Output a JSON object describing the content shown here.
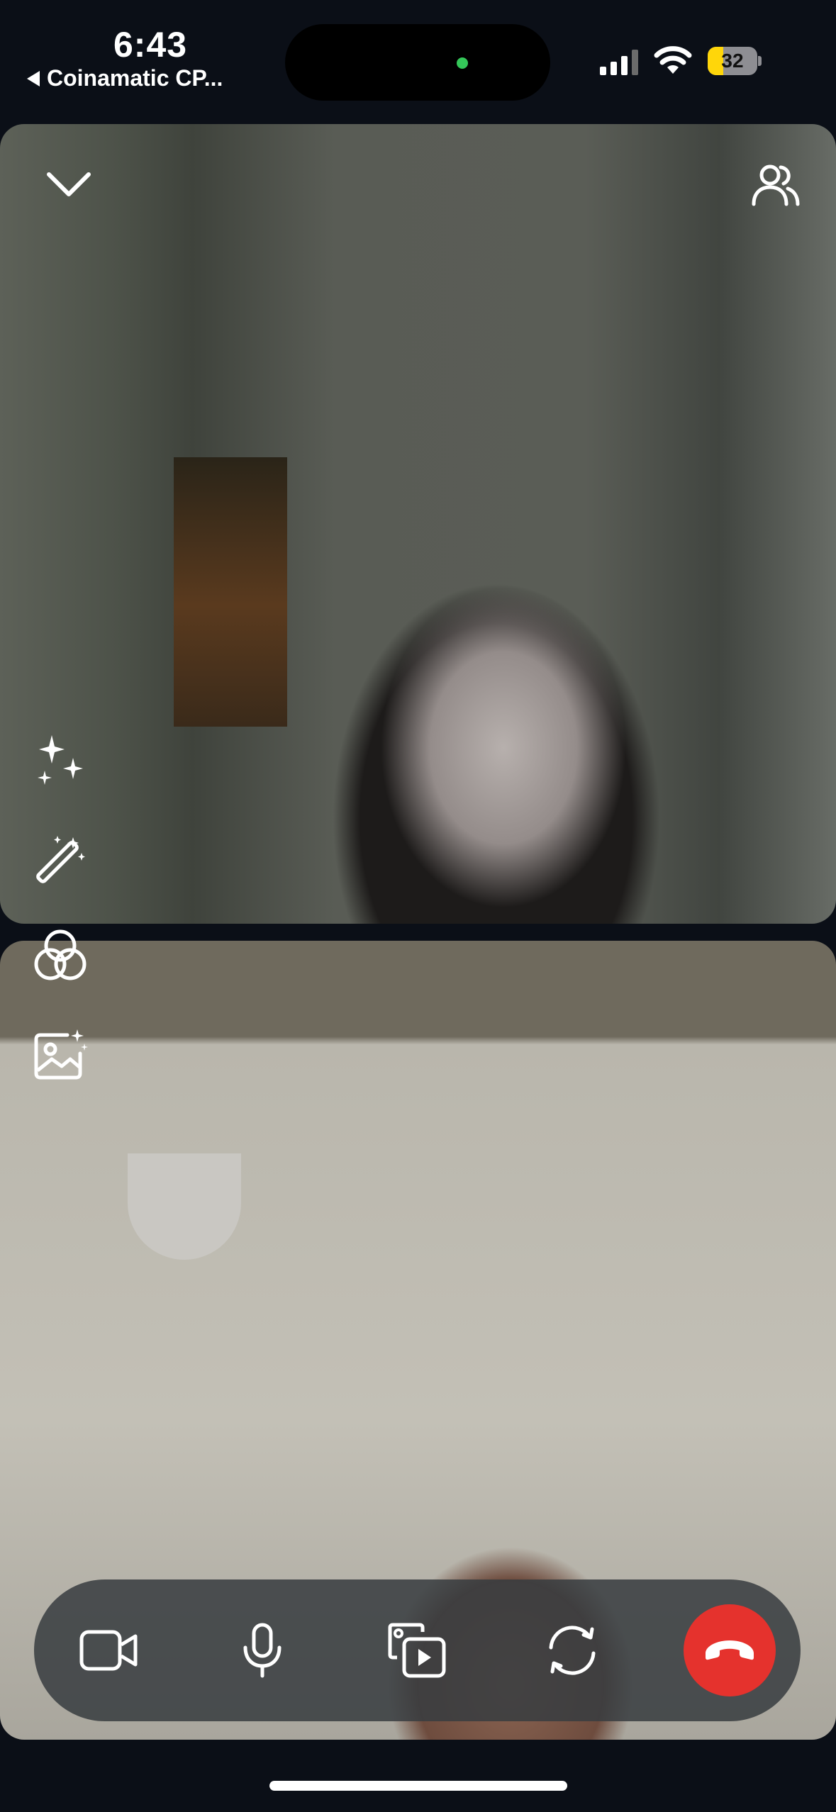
{
  "status_bar": {
    "time": "6:43",
    "back_app": "Coinamatic  CP...",
    "battery": "32",
    "battery_level": 0.32,
    "signal_bars": 3,
    "colors": {
      "battery_fill": "#ffd60a",
      "camera_indicator": "#34c759"
    }
  },
  "call": {
    "collapse_icon": "chevron-down-icon",
    "participants_icon": "people-icon",
    "side_tools": [
      "sparkles-icon",
      "magic-wand-icon",
      "filters-icon",
      "background-icon"
    ],
    "controls": [
      "video-camera-icon",
      "microphone-icon",
      "share-screen-icon",
      "flip-camera-icon",
      "end-call-icon"
    ],
    "end_call_color": "#e5322d"
  }
}
